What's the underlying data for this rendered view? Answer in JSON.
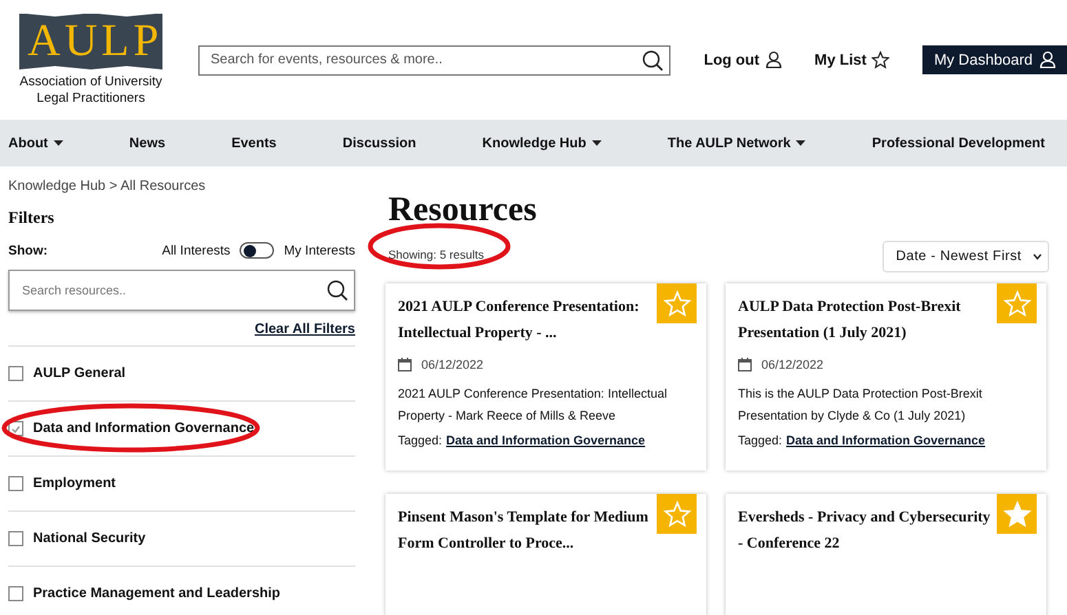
{
  "logo": {
    "mark": "AULP",
    "name": "Association of University Legal Practitioners"
  },
  "search": {
    "placeholder": "Search for events, resources & more.."
  },
  "header_links": [
    {
      "label": "Log out",
      "kind": "user"
    },
    {
      "label": "My List",
      "kind": "star"
    }
  ],
  "dashboard_button": {
    "label": "My Dashboard"
  },
  "nav": [
    {
      "label": "About",
      "dropdown": true
    },
    {
      "label": "News",
      "dropdown": false
    },
    {
      "label": "Events",
      "dropdown": false
    },
    {
      "label": "Discussion",
      "dropdown": false
    },
    {
      "label": "Knowledge Hub",
      "dropdown": true
    },
    {
      "label": "The AULP Network",
      "dropdown": true
    },
    {
      "label": "Professional Development",
      "dropdown": false
    }
  ],
  "breadcrumb": "Knowledge Hub > All Resources",
  "filters": {
    "title": "Filters",
    "show_label": "Show:",
    "toggle_left": "All Interests",
    "toggle_right": "My Interests",
    "toggle_on": false,
    "search_placeholder": "Search resources..",
    "clear": "Clear All Filters",
    "items": [
      {
        "label": "AULP General",
        "checked": false,
        "circled": false
      },
      {
        "label": "Data and Information Governance",
        "checked": true,
        "circled": true
      },
      {
        "label": "Employment",
        "checked": false,
        "circled": false
      },
      {
        "label": "National Security",
        "checked": false,
        "circled": false
      },
      {
        "label": "Practice Management and Leadership",
        "checked": false,
        "circled": false
      }
    ]
  },
  "main": {
    "title": "Resources",
    "showing": "Showing: 5 results",
    "showing_circled": true,
    "sort": "Date - Newest First",
    "cards": [
      {
        "title": "2021 AULP Conference Presentation: Intellectual Property - ...",
        "favorite": false,
        "date": "06/12/2022",
        "summary": "2021 AULP Conference Presentation: Intellectual Property - Mark Reece of Mills & Reeve",
        "tagged": "Tagged:",
        "tag": "Data and Information Governance"
      },
      {
        "title": "AULP Data Protection Post-Brexit Presentation (1 July 2021)",
        "favorite": false,
        "date": "06/12/2022",
        "summary": "This is the AULP Data Protection Post-Brexit Presentation by Clyde & Co (1 July 2021)",
        "tagged": "Tagged:",
        "tag": "Data and Information Governance"
      },
      {
        "title": "Pinsent Mason's Template for Medium Form Controller to Proce...",
        "favorite": false
      },
      {
        "title": "Eversheds - Privacy and Cybersecurity - Conference 22",
        "favorite": true
      }
    ]
  }
}
